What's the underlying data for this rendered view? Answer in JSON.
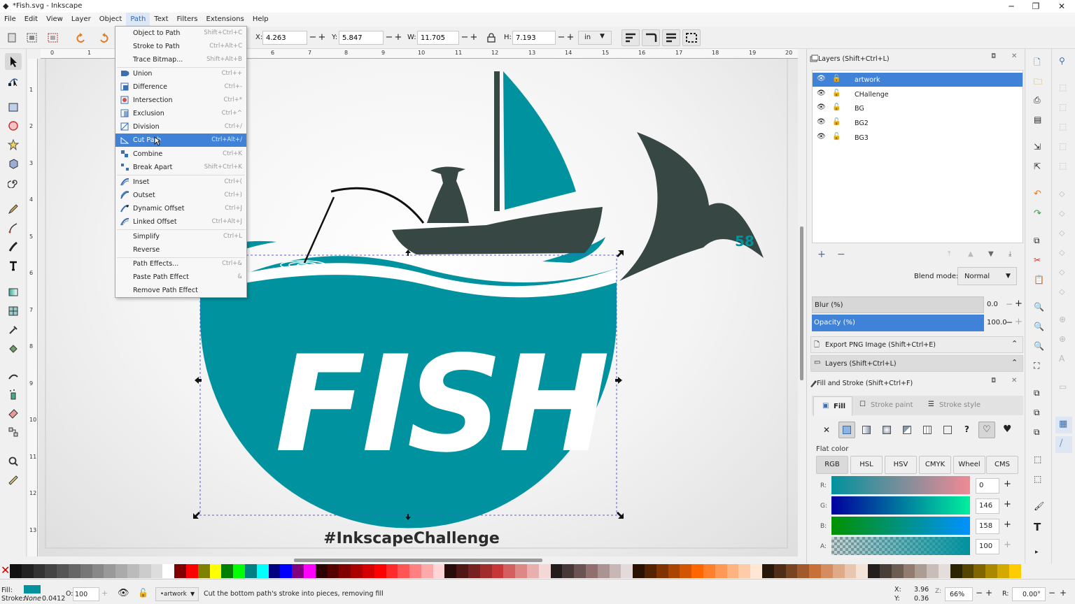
{
  "window": {
    "title": "*Fish.svg - Inkscape",
    "controls": [
      "─",
      "❐",
      "✕"
    ]
  },
  "menubar": [
    "File",
    "Edit",
    "View",
    "Layer",
    "Object",
    "Path",
    "Text",
    "Filters",
    "Extensions",
    "Help"
  ],
  "toolcontrols": {
    "x_label": "X:",
    "x_value": "4.263",
    "y_label": "Y:",
    "y_value": "5.847",
    "w_label": "W:",
    "w_value": "11.705",
    "h_label": "H:",
    "h_value": "7.193",
    "unit": "in"
  },
  "ruler": [
    "0",
    "1",
    "2",
    "3",
    "4",
    "5",
    "6",
    "7",
    "8",
    "9",
    "10",
    "11",
    "12",
    "13",
    "14",
    "15",
    "16",
    "17",
    "18",
    "19",
    "20"
  ],
  "vruler": [
    "1",
    "2",
    "3",
    "4",
    "5",
    "6",
    "7",
    "8",
    "9",
    "10",
    "11",
    "12",
    "13"
  ],
  "path_menu": [
    {
      "label": "Object to Path",
      "shortcut": "Shift+Ctrl+C",
      "icon": "none"
    },
    {
      "label": "Stroke to Path",
      "shortcut": "Ctrl+Alt+C",
      "icon": "none"
    },
    {
      "label": "Trace Bitmap...",
      "shortcut": "Shift+Alt+B",
      "icon": "none"
    },
    {
      "label": "Union",
      "shortcut": "Ctrl++",
      "icon": "union-icon"
    },
    {
      "label": "Difference",
      "shortcut": "Ctrl+-",
      "icon": "difference-icon"
    },
    {
      "label": "Intersection",
      "shortcut": "Ctrl+*",
      "icon": "intersection-icon"
    },
    {
      "label": "Exclusion",
      "shortcut": "Ctrl+^",
      "icon": "exclusion-icon"
    },
    {
      "label": "Division",
      "shortcut": "Ctrl+/",
      "icon": "division-icon"
    },
    {
      "label": "Cut Path",
      "shortcut": "Ctrl+Alt+/",
      "icon": "cut-path-icon"
    },
    {
      "label": "Combine",
      "shortcut": "Ctrl+K",
      "icon": "combine-icon"
    },
    {
      "label": "Break Apart",
      "shortcut": "Shift+Ctrl+K",
      "icon": "break-apart-icon"
    },
    {
      "label": "Inset",
      "shortcut": "Ctrl+(",
      "icon": "inset-icon"
    },
    {
      "label": "Outset",
      "shortcut": "Ctrl+)",
      "icon": "outset-icon"
    },
    {
      "label": "Dynamic Offset",
      "shortcut": "Ctrl+J",
      "icon": "dynamic-offset-icon"
    },
    {
      "label": "Linked Offset",
      "shortcut": "Ctrl+Alt+J",
      "icon": "linked-offset-icon"
    },
    {
      "label": "Simplify",
      "shortcut": "Ctrl+L",
      "icon": "none"
    },
    {
      "label": "Reverse",
      "shortcut": "",
      "icon": "none"
    },
    {
      "label": "Path Effects...",
      "shortcut": "Ctrl+&",
      "icon": "none"
    },
    {
      "label": "Paste Path Effect",
      "shortcut": "&",
      "icon": "none"
    },
    {
      "label": "Remove Path Effect",
      "shortcut": "",
      "icon": "none"
    }
  ],
  "canvas": {
    "fish_text": "FISH",
    "hashtag": "#InkscapeChallenge",
    "badge": "58",
    "colors": {
      "teal": "#00929e",
      "dark": "#364744"
    }
  },
  "layers_panel": {
    "title": "Layers (Shift+Ctrl+L)",
    "layers": [
      "artwork",
      "CHallenge",
      "BG",
      "BG2",
      "BG3"
    ],
    "blend_label": "Blend mode:",
    "blend_value": "Normal",
    "blur_label": "Blur (%)",
    "blur_value": "0.0",
    "opacity_label": "Opacity (%)",
    "opacity_value": "100.0"
  },
  "collapsed_docks": [
    "Export PNG Image (Shift+Ctrl+E)",
    "Layers (Shift+Ctrl+L)"
  ],
  "fill_stroke": {
    "title": "Fill and Stroke (Shift+Ctrl+F)",
    "tabs": [
      "Fill",
      "Stroke paint",
      "Stroke style"
    ],
    "flat_color_label": "Flat color",
    "modes": [
      "RGB",
      "HSL",
      "HSV",
      "CMYK",
      "Wheel",
      "CMS"
    ],
    "channels": [
      {
        "label": "R:",
        "value": "0"
      },
      {
        "label": "G:",
        "value": "146"
      },
      {
        "label": "B:",
        "value": "158"
      },
      {
        "label": "A:",
        "value": "100"
      }
    ]
  },
  "statusbar": {
    "fill_label": "Fill:",
    "stroke_label": "Stroke:",
    "stroke_value": "None",
    "stroke_width": "0.0412",
    "opacity_label": "O:",
    "opacity_value": "100",
    "layer": "•artwork",
    "message": "Cut the bottom path's stroke into pieces, removing fill",
    "x_label": "X:",
    "x_value": "3.96",
    "y_label": "Y:",
    "y_value": "0.36",
    "zoom": "66%",
    "rot_label": "R:",
    "rotation": "0.00°"
  },
  "palette": [
    "#111111",
    "#222222",
    "#333333",
    "#444444",
    "#555555",
    "#666666",
    "#777777",
    "#888888",
    "#999999",
    "#aaaaaa",
    "#bbbbbb",
    "#cccccc",
    "#dddddd",
    "#ffffff",
    "#800000",
    "#ff0000",
    "#808000",
    "#ffff00",
    "#008000",
    "#00ff00",
    "#008080",
    "#00ffff",
    "#000080",
    "#0000ff",
    "#800080",
    "#ff00ff",
    "#2b0000",
    "#550000",
    "#800000",
    "#aa0000",
    "#d40000",
    "#ff0000",
    "#ff2a2a",
    "#ff5555",
    "#ff8080",
    "#ffaaaa",
    "#ffd5d5",
    "#280b0b",
    "#501616",
    "#782121",
    "#a02c2c",
    "#c83737",
    "#d35f5f",
    "#de8787",
    "#e9afaf",
    "#f4d7d7",
    "#241c1c",
    "#483737",
    "#6c5353",
    "#916f6f",
    "#ac9393",
    "#c8b7b7",
    "#e3dbdb",
    "#2b1100",
    "#552200",
    "#803300",
    "#aa4400",
    "#d45500",
    "#ff6600",
    "#ff7f2a",
    "#ff9955",
    "#ffb380",
    "#ffccaa",
    "#ffe6d5",
    "#28170b",
    "#502d16",
    "#784421",
    "#a05a2c",
    "#c87137",
    "#d38d5f",
    "#deaa87",
    "#e9c6af",
    "#f4e3d7",
    "#241f1c",
    "#483e37",
    "#6c5d53",
    "#917c6f",
    "#ac9d93",
    "#c8beb7",
    "#e3dedb",
    "#2b2200",
    "#554400",
    "#806600",
    "#aa8800",
    "#d4aa00",
    "#ffcc00"
  ]
}
